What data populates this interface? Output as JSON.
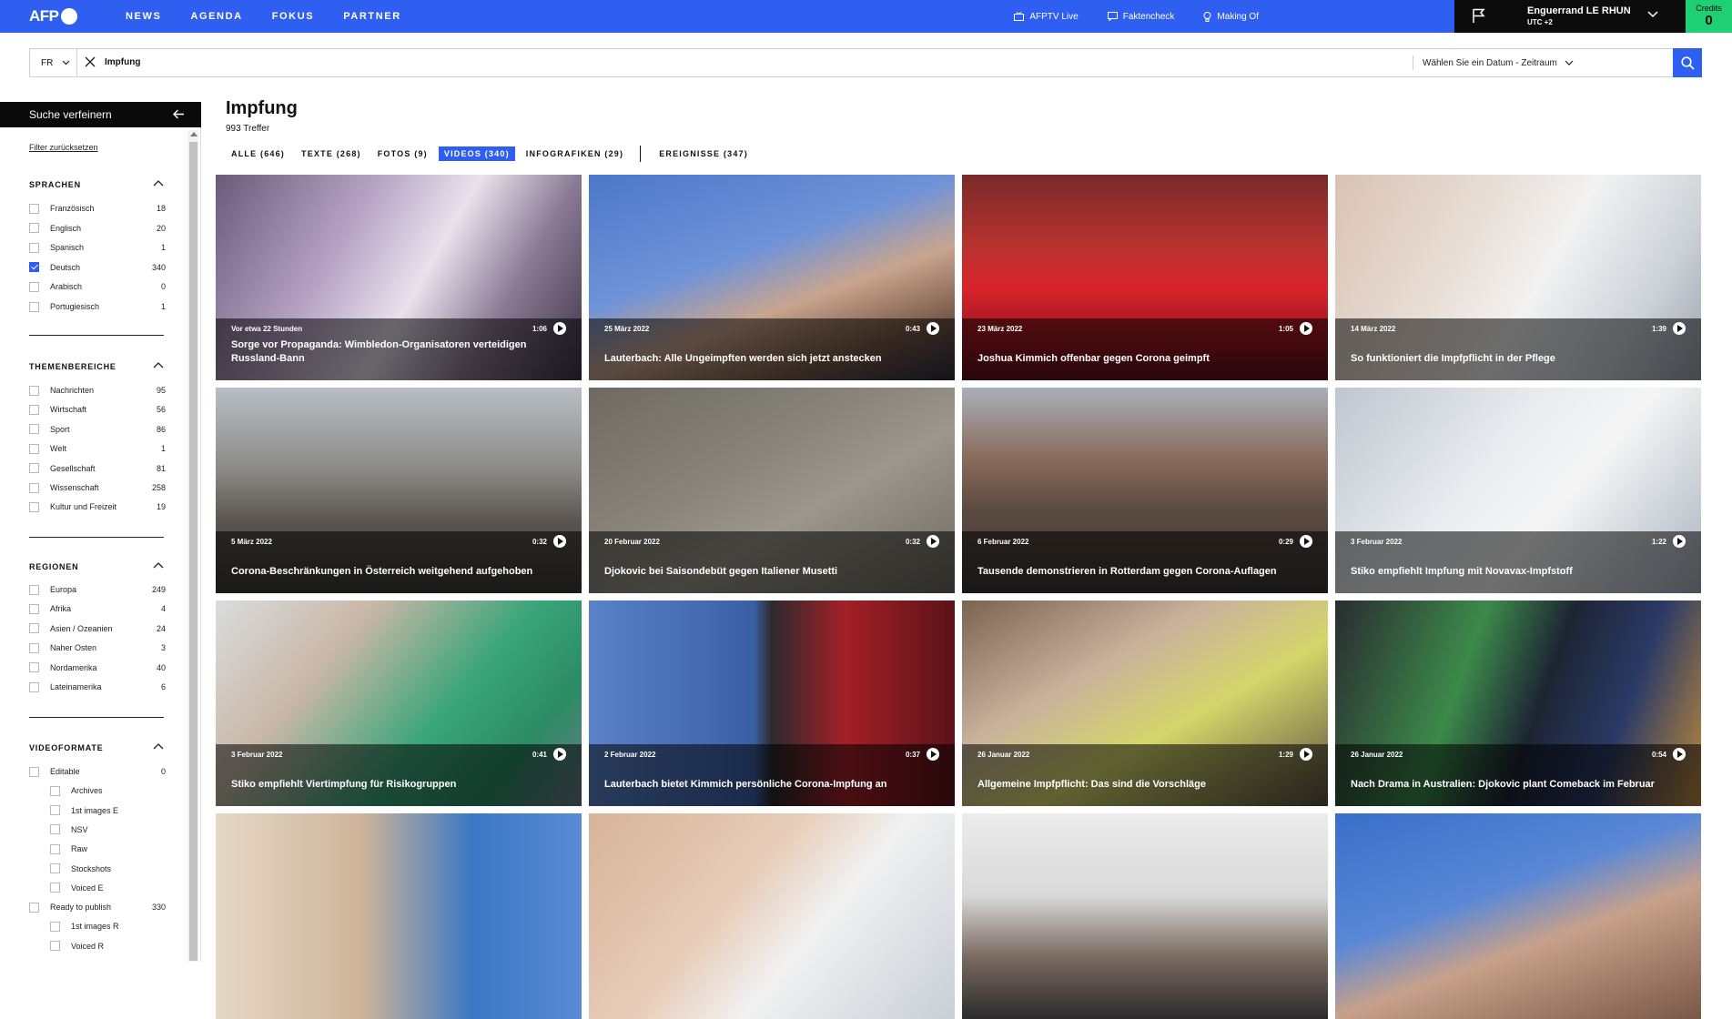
{
  "brand": {
    "logo_text": "AFP"
  },
  "nav": {
    "items": [
      "NEWS",
      "AGENDA",
      "FOKUS",
      "PARTNER"
    ],
    "right": [
      {
        "label": "AFPTV Live",
        "icon": "tv-icon"
      },
      {
        "label": "Faktencheck",
        "icon": "chat-icon"
      },
      {
        "label": "Making Of",
        "icon": "lightbulb-icon"
      }
    ]
  },
  "user": {
    "name": "Enguerrand LE RHUN",
    "timezone": "UTC +2"
  },
  "credits": {
    "label": "Credits",
    "value": "0"
  },
  "search": {
    "lang": "FR",
    "query": "Impfung",
    "date_placeholder": "Wählen Sie ein Datum - Zeitraum"
  },
  "sidebar": {
    "title": "Suche verfeinern",
    "reset": "Filter zurücksetzen",
    "sections": [
      {
        "title": "SPRACHEN",
        "items": [
          {
            "label": "Französisch",
            "count": "18",
            "checked": false
          },
          {
            "label": "Englisch",
            "count": "20",
            "checked": false
          },
          {
            "label": "Spanisch",
            "count": "1",
            "checked": false
          },
          {
            "label": "Deutsch",
            "count": "340",
            "checked": true
          },
          {
            "label": "Arabisch",
            "count": "0",
            "checked": false
          },
          {
            "label": "Portugiesisch",
            "count": "1",
            "checked": false
          }
        ]
      },
      {
        "title": "THEMENBEREICHE",
        "items": [
          {
            "label": "Nachrichten",
            "count": "95",
            "checked": false
          },
          {
            "label": "Wirtschaft",
            "count": "56",
            "checked": false
          },
          {
            "label": "Sport",
            "count": "86",
            "checked": false
          },
          {
            "label": "Welt",
            "count": "1",
            "checked": false
          },
          {
            "label": "Gesellschaft",
            "count": "81",
            "checked": false
          },
          {
            "label": "Wissenschaft",
            "count": "258",
            "checked": false
          },
          {
            "label": "Kultur und Freizeit",
            "count": "19",
            "checked": false
          }
        ]
      },
      {
        "title": "REGIONEN",
        "items": [
          {
            "label": "Europa",
            "count": "249",
            "checked": false
          },
          {
            "label": "Afrika",
            "count": "4",
            "checked": false
          },
          {
            "label": "Asien / Ozeanien",
            "count": "24",
            "checked": false
          },
          {
            "label": "Naher Osten",
            "count": "3",
            "checked": false
          },
          {
            "label": "Nordamerika",
            "count": "40",
            "checked": false
          },
          {
            "label": "Lateinamerika",
            "count": "6",
            "checked": false
          }
        ]
      },
      {
        "title": "VIDEOFORMATE",
        "items": [
          {
            "label": "Editable",
            "count": "0",
            "checked": false,
            "indent": false
          },
          {
            "label": "Archives",
            "count": "",
            "checked": false,
            "indent": true
          },
          {
            "label": "1st images E",
            "count": "",
            "checked": false,
            "indent": true
          },
          {
            "label": "NSV",
            "count": "",
            "checked": false,
            "indent": true
          },
          {
            "label": "Raw",
            "count": "",
            "checked": false,
            "indent": true
          },
          {
            "label": "Stockshots",
            "count": "",
            "checked": false,
            "indent": true
          },
          {
            "label": "Voiced E",
            "count": "",
            "checked": false,
            "indent": true
          },
          {
            "label": "Ready to publish",
            "count": "330",
            "checked": false,
            "indent": false
          },
          {
            "label": "1st images R",
            "count": "",
            "checked": false,
            "indent": true
          },
          {
            "label": "Voiced R",
            "count": "",
            "checked": false,
            "indent": true
          }
        ]
      }
    ]
  },
  "main": {
    "title": "Impfung",
    "hits": "993 Treffer",
    "tabs": [
      {
        "label": "ALLE (646)",
        "active": false
      },
      {
        "label": "TEXTE (268)",
        "active": false
      },
      {
        "label": "FOTOS (9)",
        "active": false
      },
      {
        "label": "VIDEOS (340)",
        "active": true
      },
      {
        "label": "INFOGRAFIKEN (29)",
        "active": false
      },
      {
        "label": "EREIGNISSE (347)",
        "active": false,
        "after_separator": true
      }
    ],
    "cards": [
      {
        "date": "Vor etwa 22 Stunden",
        "duration": "1:06",
        "title": "Sorge vor Propaganda: Wimbledon-Organisatoren verteidigen Russland-Bann",
        "bg": "linear-gradient(120deg,#6b5a7a 0%,#b9a6c6 35%,#e8e2ec 55%,#8b7b95 75%,#3d3346 100%)"
      },
      {
        "date": "25 März 2022",
        "duration": "0:43",
        "title": "Lauterbach: Alle Ungeimpften werden sich jetzt anstecken",
        "bg": "linear-gradient(160deg,#4c77c9 0%,#6f93d8 40%,#c9a58e 60%,#7c5c4b 80%,#2b2b3a 100%)"
      },
      {
        "date": "23 März 2022",
        "duration": "1:05",
        "title": "Joshua Kimmich offenbar gegen Corona geimpft",
        "bg": "linear-gradient(180deg,#7a2a2a 0%,#b8322f 35%,#d8232a 55%,#9c1520 80%,#5c1014 100%)"
      },
      {
        "date": "14 März 2022",
        "duration": "1:39",
        "title": "So funktioniert die Impfpflicht in der Pflege",
        "bg": "linear-gradient(120deg,#d9c2b4 0%,#e8ded6 35%,#f2f2f2 55%,#cdd2d8 80%,#9aa3ad 100%)"
      },
      {
        "date": "5 März 2022",
        "duration": "0:32",
        "title": "Corona-Beschränkungen in Österreich weitgehend aufgehoben",
        "bg": "linear-gradient(180deg,#b9bec4 0%,#8b8a86 40%,#5a5550 65%,#3d3a38 100%)"
      },
      {
        "date": "20 Februar 2022",
        "duration": "0:32",
        "title": "Djokovic bei Saisondebüt gegen Italiener Musetti",
        "bg": "linear-gradient(150deg,#6e6a62 0%,#8a857b 40%,#9c978d 60%,#6d685f 100%)"
      },
      {
        "date": "6 Februar 2022",
        "duration": "0:29",
        "title": "Tausende demonstrieren in Rotterdam gegen Corona-Auflagen",
        "bg": "linear-gradient(180deg,#a8b0ba 0%,#8a6a5a 35%,#5a4a40 60%,#3a3633 100%)"
      },
      {
        "date": "3 Februar 2022",
        "duration": "1:22",
        "title": "Stiko empfiehlt Impfung mit Novavax-Impfstoff",
        "bg": "linear-gradient(130deg,#bfc6cf 0%,#e9ecef 40%,#f5f5f5 60%,#a9b3be 100%)"
      },
      {
        "date": "3 Februar 2022",
        "duration": "0:41",
        "title": "Stiko empfiehlt Viertimpfung für Risikogruppen",
        "bg": "linear-gradient(130deg,#d9dcde 0%,#c9b7a7 30%,#3aa57a 60%,#2c8c64 80%,#6a7a8a 100%)"
      },
      {
        "date": "2 Februar 2022",
        "duration": "0:37",
        "title": "Lauterbach bietet Kimmich persönliche Corona-Impfung an",
        "bg": "linear-gradient(90deg,#5a82c8 0%,#3b5fa6 45%,#2c2a2d 50%,#a32027 70%,#5c1218 100%)"
      },
      {
        "date": "26 Januar 2022",
        "duration": "1:29",
        "title": "Allgemeine Impfpflicht: Das sind die Vorschläge",
        "bg": "linear-gradient(150deg,#7a6452 0%,#c9b29c 35%,#d4d66a 60%,#5a5040 100%)"
      },
      {
        "date": "26 Januar 2022",
        "duration": "0:54",
        "title": "Nach Drama in Australien: Djokovic plant Comeback im Februar",
        "bg": "linear-gradient(110deg,#2a2c30 0%,#3c8a4a 35%,#1d2433 55%,#2a3a66 75%,#c08a3a 100%)"
      },
      {
        "date": "",
        "duration": "",
        "title": "",
        "bg": "linear-gradient(90deg,#e6d8c6 0%,#cdb49a 40%,#3b78c4 70%,#5a8ad4 100%)"
      },
      {
        "date": "",
        "duration": "",
        "title": "",
        "bg": "linear-gradient(130deg,#d7b39a 0%,#e7cdb9 40%,#f1f1f1 60%,#c9cfd6 100%)"
      },
      {
        "date": "",
        "duration": "",
        "title": "",
        "bg": "linear-gradient(180deg,#ececec 0%,#d9d9d9 40%,#7a6a60 70%,#2b2b2b 100%)"
      },
      {
        "date": "",
        "duration": "",
        "title": "",
        "bg": "linear-gradient(160deg,#3a6ec8 0%,#5a88d6 40%,#c7a18a 60%,#7a5848 100%)"
      }
    ]
  },
  "colors": {
    "accent": "#2f5ff0",
    "credits": "#1fcf74",
    "dark": "#0a0a0a"
  }
}
